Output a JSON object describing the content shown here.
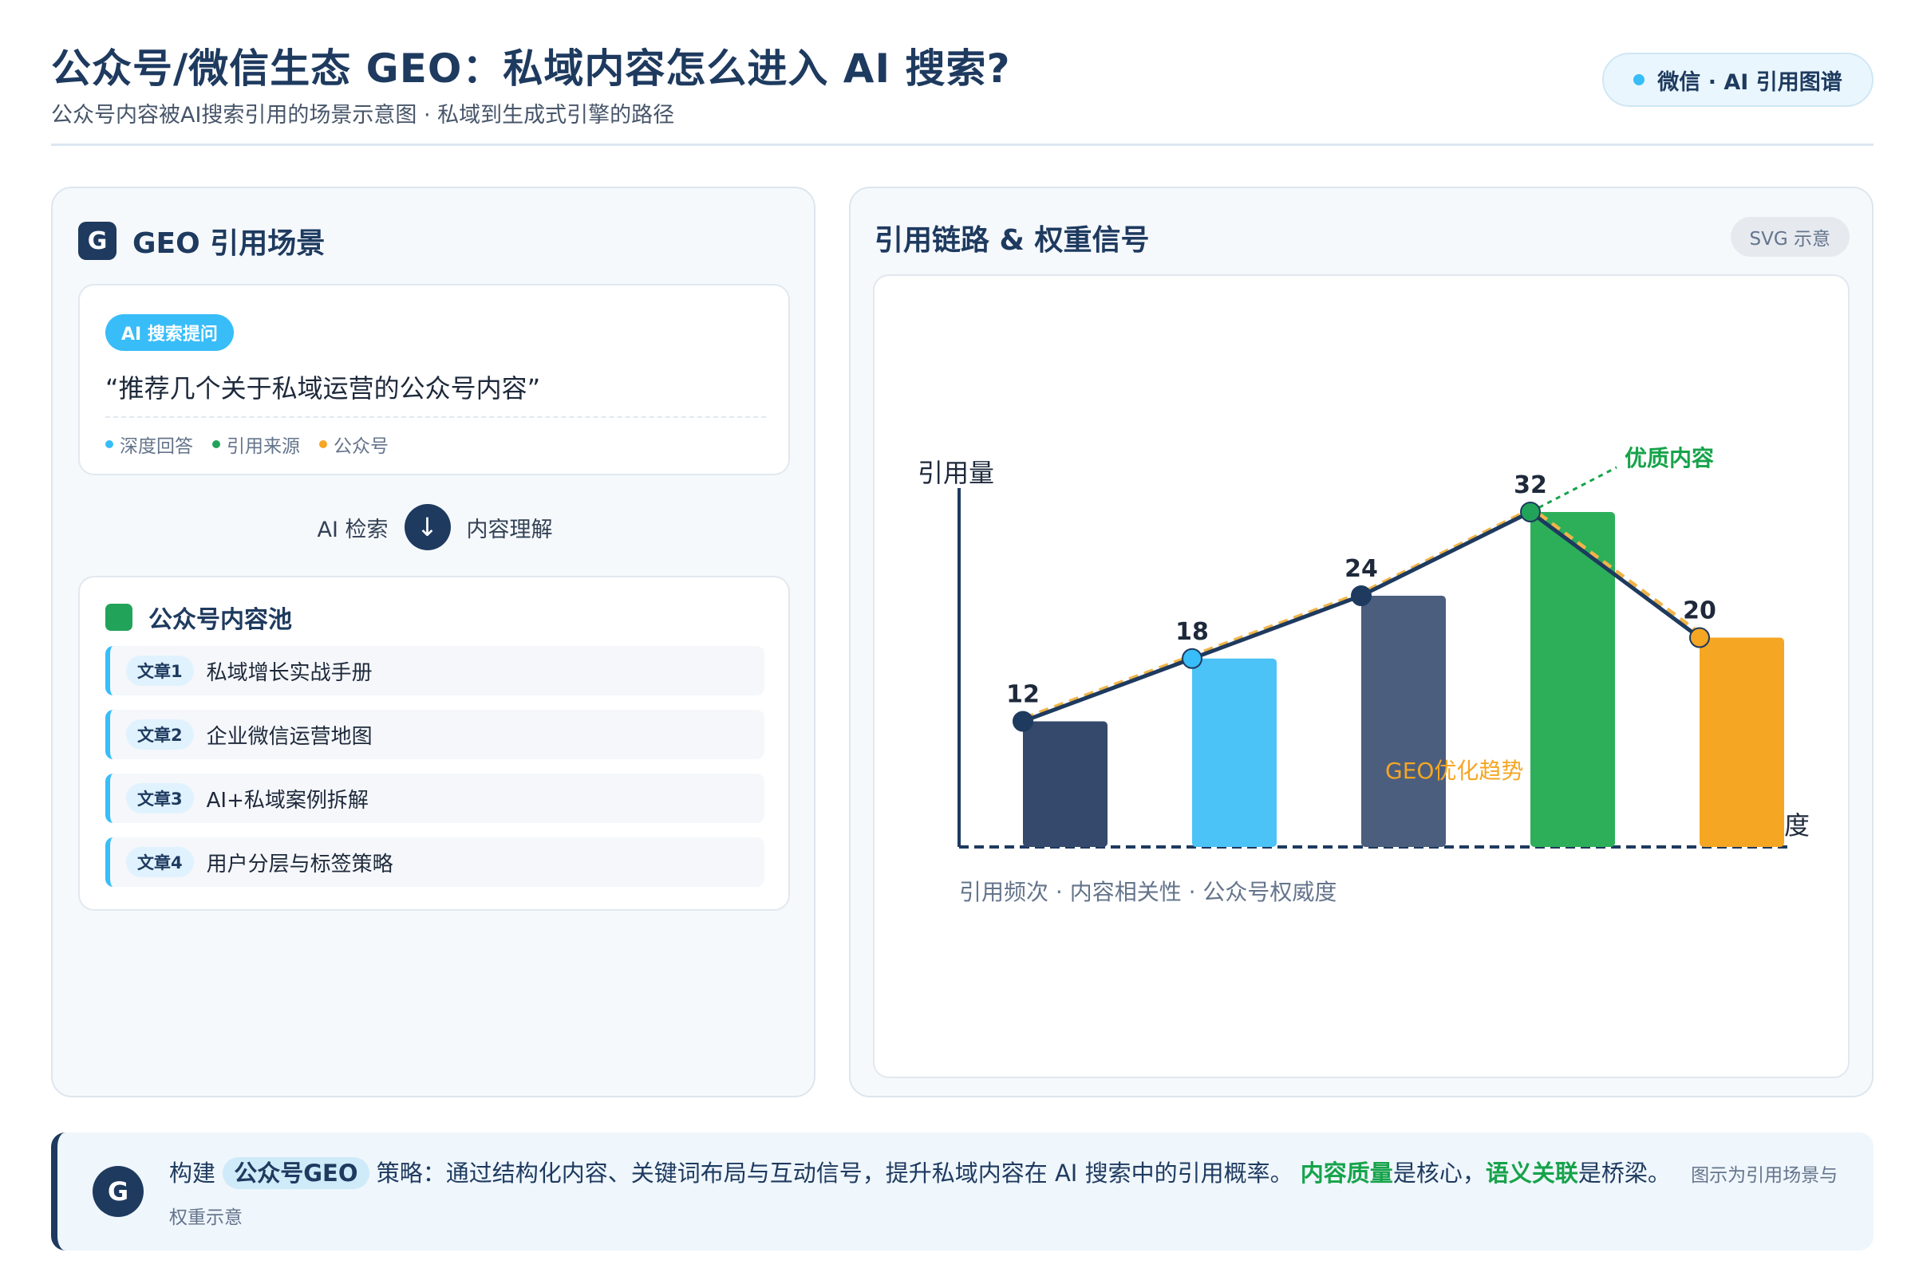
{
  "header": {
    "title": "公众号/微信生态 GEO：私域内容怎么进入 AI 搜索?",
    "subtitle": "公众号内容被AI搜索引用的场景示意图 · 私域到生成式引擎的路径",
    "badge": "微信 · AI 引用图谱"
  },
  "left_panel": {
    "badge_letter": "G",
    "title": "GEO 引用场景",
    "query": {
      "pill": "AI 搜索提问",
      "text": "“推荐几个关于私域运营的公众号内容”",
      "tags": [
        {
          "label": "深度回答",
          "color": "#38bdf8"
        },
        {
          "label": "引用来源",
          "color": "#22a35a"
        },
        {
          "label": "公众号",
          "color": "#f5a623"
        }
      ]
    },
    "flow": {
      "left": "AI 检索",
      "arrow": "↓",
      "right": "内容理解"
    },
    "pool": {
      "title": "公众号内容池",
      "articles": [
        {
          "tag": "文章1",
          "title": "私域增长实战手册"
        },
        {
          "tag": "文章2",
          "title": "企业微信运营地图"
        },
        {
          "tag": "文章3",
          "title": "AI+私域案例拆解"
        },
        {
          "tag": "文章4",
          "title": "用户分层与标签策略"
        }
      ]
    }
  },
  "right_panel": {
    "title": "引用链路 & 权重信号",
    "badge": "SVG 示意"
  },
  "chart_data": {
    "type": "bar",
    "categories": [
      "",
      "",
      "",
      "",
      ""
    ],
    "values": [
      12,
      18,
      24,
      32,
      20
    ],
    "colors": [
      "#34496b",
      "#4cc3f7",
      "#4b5e7e",
      "#2daf5a",
      "#f5a623"
    ],
    "ylabel": "引用量",
    "xlabel": "内容深度",
    "ylim": [
      0,
      40
    ],
    "line_overlay": true,
    "trend_label": "GEO优化趋势",
    "highlight_label": "优质内容",
    "caption": "引用频次 · 内容相关性 · 公众号权威度",
    "grid": false
  },
  "footer": {
    "badge_letter": "G",
    "prefix": "构建",
    "highlight": "公众号GEO",
    "middle": "策略：通过结构化内容、关键词布局与互动信号，提升私域内容在 AI 搜索中的引用概率。",
    "green1": "内容质量",
    "mid2": "是核心，",
    "green2": "语义关联",
    "suffix": "是桥梁。",
    "note": "图示为引用场景与权重示意"
  }
}
